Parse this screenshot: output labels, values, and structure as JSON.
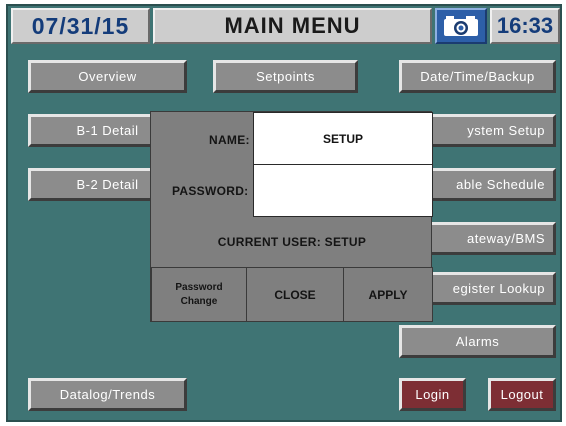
{
  "header": {
    "date": "07/31/15",
    "title": "MAIN MENU",
    "camera_icon": "camera-icon",
    "time": "16:33"
  },
  "menu": {
    "overview": "Overview",
    "setpoints": "Setpoints",
    "date_time_backup": "Date/Time/Backup",
    "b1_detail": "B-1 Detail",
    "system_setup": "ystem Setup",
    "b2_detail": "B-2 Detail",
    "enable_schedule": "able Schedule",
    "gateway_bms": "ateway/BMS",
    "register_lookup": "egister Lookup",
    "alarms": "Alarms",
    "datalog_trends": "Datalog/Trends",
    "login": "Login",
    "logout": "Logout"
  },
  "login_dialog": {
    "name_label": "NAME:",
    "name_value": "SETUP",
    "password_label": "PASSWORD:",
    "password_value": "",
    "current_user": "CURRENT USER: SETUP",
    "password_change_line1": "Password",
    "password_change_line2": "Change",
    "close": "CLOSE",
    "apply": "APPLY"
  },
  "colors": {
    "background": "#3f7474",
    "header_text": "#143c7a",
    "button": "#8c8c8c",
    "login_button": "#7d2e34"
  }
}
